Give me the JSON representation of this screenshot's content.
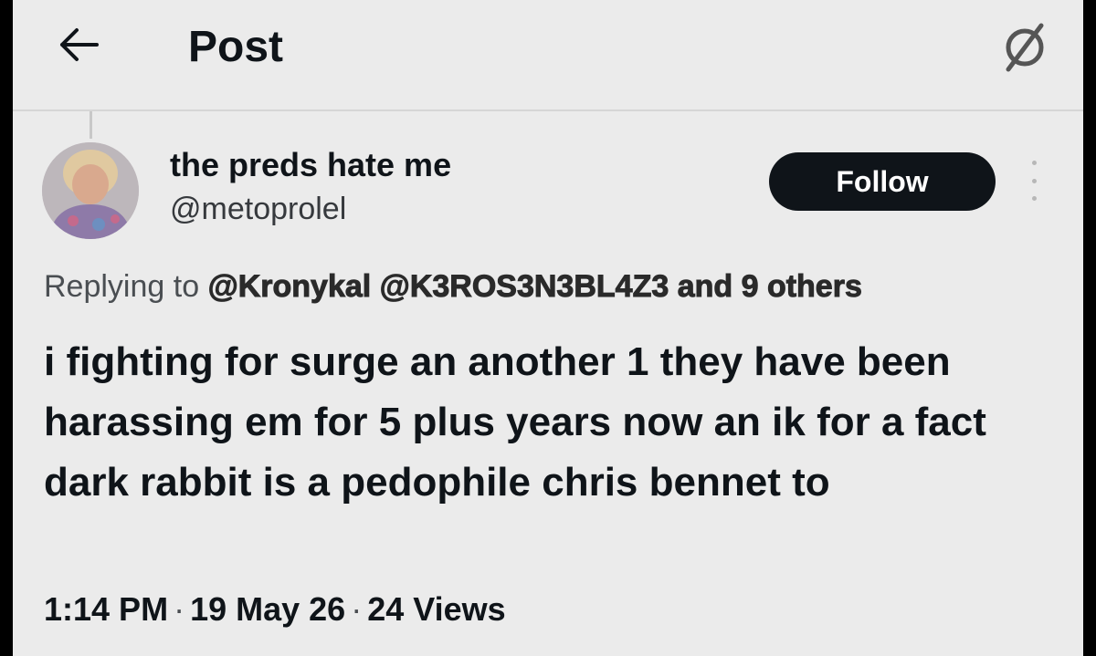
{
  "header": {
    "title": "Post",
    "back_icon": "arrow-left-icon",
    "grok_icon": "grok-slash-icon"
  },
  "author": {
    "display_name": "the preds hate me",
    "handle": "@metoprolel",
    "follow_label": "Follow"
  },
  "reply": {
    "prefix": "Replying to",
    "mentions": [
      "@Kronykal",
      "@K3ROS3N3BL4Z3",
      "and 9 others"
    ]
  },
  "post": {
    "text": "i fighting for surge an another 1 they have been harassing em for 5 plus years now an ik for a fact dark rabbit is a pedophile chris bennet to"
  },
  "meta": {
    "time": "1:14 PM",
    "date": "19 May 26",
    "views": "24 Views",
    "separator": "·"
  },
  "colors": {
    "background": "#ebebeb",
    "text": "#0f1419",
    "follow_bg": "#0f1419",
    "follow_text": "#ffffff"
  }
}
